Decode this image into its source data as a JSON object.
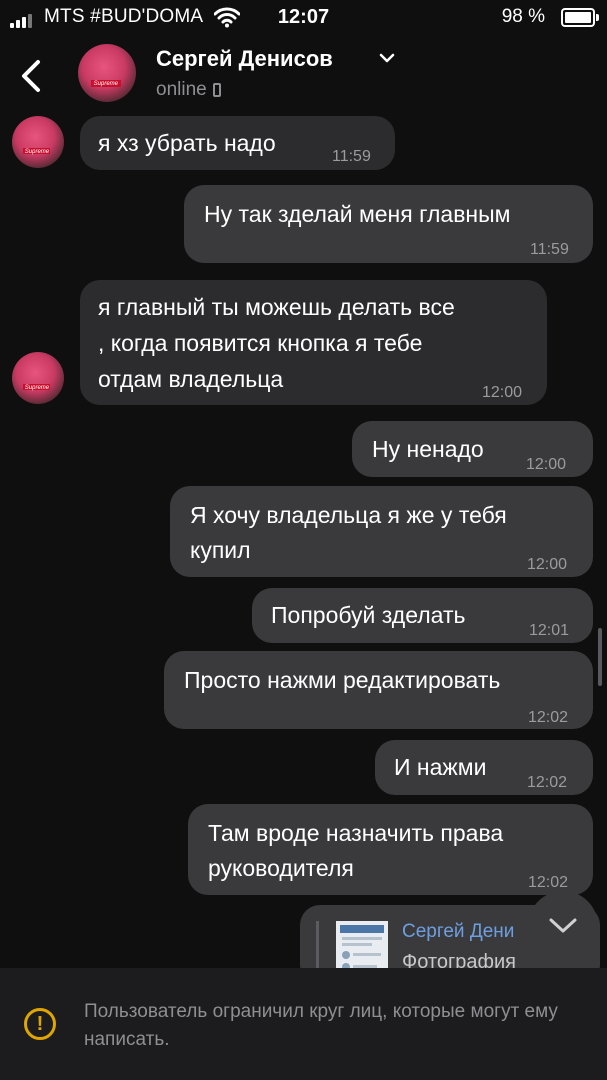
{
  "status_bar": {
    "carrier": "MTS #BUD'DOMA",
    "time": "12:07",
    "battery": "98 %"
  },
  "header": {
    "back_icon": "chevron-left-icon",
    "name": "Сергей Денисов",
    "status": "online"
  },
  "messages": [
    {
      "dir": "in",
      "text": "я хз убрать надо",
      "time": "11:59"
    },
    {
      "dir": "out",
      "text": "Ну так зделай меня главным",
      "time": "11:59"
    },
    {
      "dir": "in",
      "lines": [
        "я главный ты можешь делать все",
        ", когда появится кнопка я тебе",
        "отдам владельца"
      ],
      "time": "12:00"
    },
    {
      "dir": "out",
      "text": "Ну ненадо",
      "time": "12:00"
    },
    {
      "dir": "out",
      "lines": [
        "Я хочу владельца я же у тебя",
        "купил"
      ],
      "time": "12:00"
    },
    {
      "dir": "out",
      "text": "Попробуй зделать",
      "time": "12:01"
    },
    {
      "dir": "out",
      "text": "Просто нажми редактировать",
      "time": "12:02"
    },
    {
      "dir": "out",
      "text": "И нажми",
      "time": "12:02"
    },
    {
      "dir": "out",
      "lines": [
        "Там вроде назначить права",
        "руководителя"
      ],
      "time": "12:02"
    }
  ],
  "forwarded": {
    "name": "Сергей Дени",
    "subtitle": "Фотография"
  },
  "footer": {
    "notice": "Пользователь ограничил круг лиц, которые могут ему написать."
  },
  "colors": {
    "background": "#0f0f0f",
    "bubble_in": "#2c2c2e",
    "bubble_out": "#3a3a3c",
    "link": "#6d9fe0",
    "warning": "#e0a500"
  }
}
